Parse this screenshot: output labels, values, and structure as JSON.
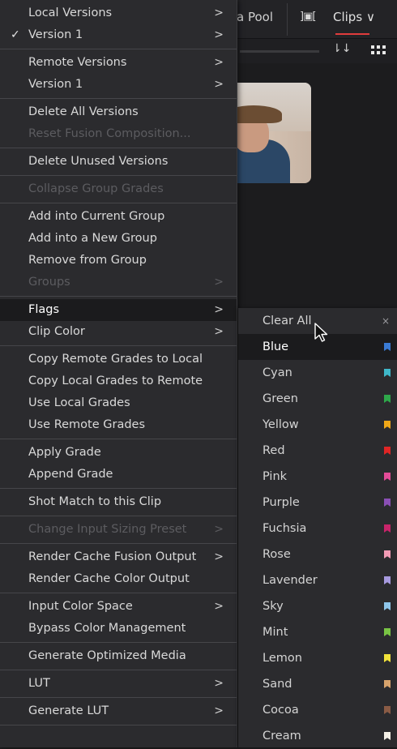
{
  "background": {
    "pool_tab": "a Pool",
    "clips_dropdown": "Clips",
    "icons": [
      "viewer-toggle-icon",
      "sort-icon",
      "grid-view-icon",
      "chevron-down-icon"
    ],
    "accent_color": "#e03c3c"
  },
  "menu": {
    "sections": [
      [
        {
          "label": "Local Versions",
          "submenu": true
        },
        {
          "label": "Version 1",
          "submenu": true,
          "checked": true
        }
      ],
      [
        {
          "label": "Remote Versions",
          "submenu": true
        },
        {
          "label": "Version 1",
          "submenu": true
        }
      ],
      [
        {
          "label": "Delete All Versions"
        },
        {
          "label": "Reset Fusion Composition...",
          "disabled": true
        }
      ],
      [
        {
          "label": "Delete Unused Versions"
        }
      ],
      [
        {
          "label": "Collapse Group Grades",
          "disabled": true
        }
      ],
      [
        {
          "label": "Add into Current Group"
        },
        {
          "label": "Add into a New Group"
        },
        {
          "label": "Remove from Group"
        },
        {
          "label": "Groups",
          "submenu": true,
          "disabled": true
        }
      ],
      [
        {
          "label": "Flags",
          "submenu": true,
          "active": true
        },
        {
          "label": "Clip Color",
          "submenu": true
        }
      ],
      [
        {
          "label": "Copy Remote Grades to Local"
        },
        {
          "label": "Copy Local Grades to Remote"
        },
        {
          "label": "Use Local Grades"
        },
        {
          "label": "Use Remote Grades"
        }
      ],
      [
        {
          "label": "Apply Grade"
        },
        {
          "label": "Append Grade"
        }
      ],
      [
        {
          "label": "Shot Match to this Clip"
        }
      ],
      [
        {
          "label": "Change Input Sizing Preset",
          "submenu": true,
          "disabled": true
        }
      ],
      [
        {
          "label": "Render Cache Fusion Output",
          "submenu": true
        },
        {
          "label": "Render Cache Color Output"
        }
      ],
      [
        {
          "label": "Input Color Space",
          "submenu": true
        },
        {
          "label": "Bypass Color Management"
        }
      ],
      [
        {
          "label": "Generate Optimized Media"
        }
      ],
      [
        {
          "label": "LUT",
          "submenu": true
        }
      ],
      [
        {
          "label": "Generate LUT",
          "submenu": true
        }
      ]
    ],
    "submenu_arrow": ">",
    "check_mark": "✓"
  },
  "flags_submenu": {
    "clear_all": "Clear All",
    "close_glyph": "×",
    "items": [
      {
        "label": "Blue",
        "color": "#3a7bd5",
        "selected": true
      },
      {
        "label": "Cyan",
        "color": "#3fb8c9"
      },
      {
        "label": "Green",
        "color": "#2ea84a"
      },
      {
        "label": "Yellow",
        "color": "#f0a818"
      },
      {
        "label": "Red",
        "color": "#e02525"
      },
      {
        "label": "Pink",
        "color": "#e44c98"
      },
      {
        "label": "Purple",
        "color": "#8a4fb5"
      },
      {
        "label": "Fuchsia",
        "color": "#c8246a"
      },
      {
        "label": "Rose",
        "color": "#f29bb5"
      },
      {
        "label": "Lavender",
        "color": "#a79adf"
      },
      {
        "label": "Sky",
        "color": "#8ec6ea"
      },
      {
        "label": "Mint",
        "color": "#79c444"
      },
      {
        "label": "Lemon",
        "color": "#f1e23a"
      },
      {
        "label": "Sand",
        "color": "#d7a36c"
      },
      {
        "label": "Cocoa",
        "color": "#8a5b45"
      },
      {
        "label": "Cream",
        "color": "#f4f0e6"
      }
    ]
  }
}
